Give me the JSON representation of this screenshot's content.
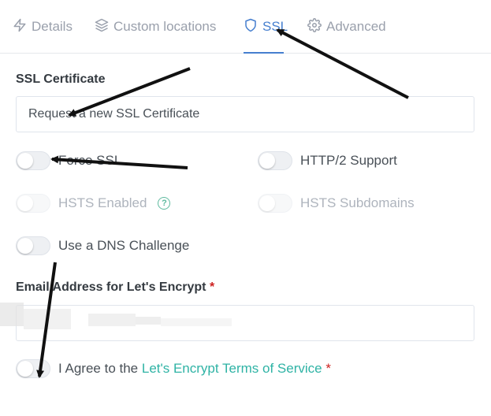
{
  "tabs": [
    {
      "label": "Details",
      "icon": "bolt-icon",
      "active": false
    },
    {
      "label": "Custom locations",
      "icon": "layers-icon",
      "active": false
    },
    {
      "label": "SSL",
      "icon": "shield-icon",
      "active": true
    },
    {
      "label": "Advanced",
      "icon": "gear-icon",
      "active": false
    }
  ],
  "ssl_certificate": {
    "label": "SSL Certificate",
    "value": "Request a new SSL Certificate"
  },
  "toggles": {
    "force_ssl": {
      "label": "Force SSL",
      "on": false,
      "enabled": true
    },
    "http2": {
      "label": "HTTP/2 Support",
      "on": false,
      "enabled": true
    },
    "hsts": {
      "label": "HSTS Enabled",
      "on": false,
      "enabled": false
    },
    "hsts_subdomains": {
      "label": "HSTS Subdomains",
      "on": false,
      "enabled": false
    },
    "dns_challenge": {
      "label": "Use a DNS Challenge",
      "on": false,
      "enabled": true
    }
  },
  "email": {
    "label": "Email Address for Let's Encrypt",
    "required_mark": "*",
    "value": ""
  },
  "agree": {
    "prefix": "I Agree to the ",
    "link": "Let's Encrypt Terms of Service",
    "required_mark": "*",
    "on": false
  },
  "colors": {
    "accent": "#467fcf",
    "link": "#2fb3a5",
    "required": "#cd201f"
  }
}
